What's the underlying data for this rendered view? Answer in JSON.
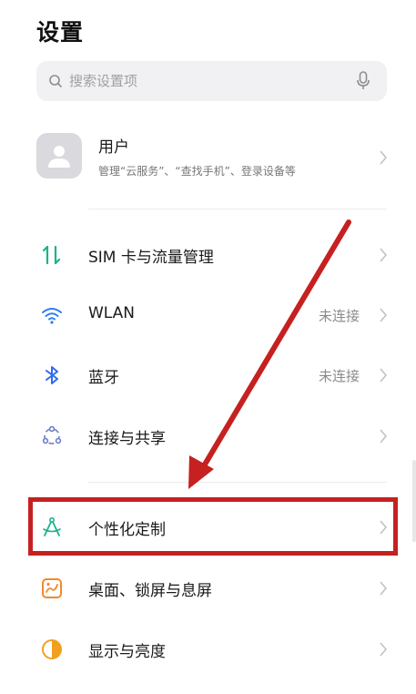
{
  "header": {
    "title": "设置"
  },
  "search": {
    "placeholder": "搜索设置项"
  },
  "account": {
    "name": "用户",
    "description": "管理“云服务”、“查找手机”、登录设备等"
  },
  "settings": [
    {
      "id": "sim",
      "label": "SIM 卡与流量管理",
      "value": "",
      "icon": "sim-data-icon",
      "color": "#1bb38a"
    },
    {
      "id": "wlan",
      "label": "WLAN",
      "value": "未连接",
      "icon": "wifi-icon",
      "color": "#2e7cf6"
    },
    {
      "id": "bluetooth",
      "label": "蓝牙",
      "value": "未连接",
      "icon": "bluetooth-icon",
      "color": "#2e6cf0"
    },
    {
      "id": "connection",
      "label": "连接与共享",
      "value": "",
      "icon": "connection-share-icon",
      "color": "#6a7ec9"
    },
    {
      "id": "personalize",
      "label": "个性化定制",
      "value": "",
      "icon": "compass-icon",
      "color": "#1bb38a"
    },
    {
      "id": "desktop",
      "label": "桌面、锁屏与息屏",
      "value": "",
      "icon": "desktop-lockscreen-icon",
      "color": "#f08a2c"
    },
    {
      "id": "display",
      "label": "显示与亮度",
      "value": "",
      "icon": "brightness-icon",
      "color": "#f0a020"
    }
  ],
  "annotation": {
    "highlight_color": "#c62020"
  }
}
